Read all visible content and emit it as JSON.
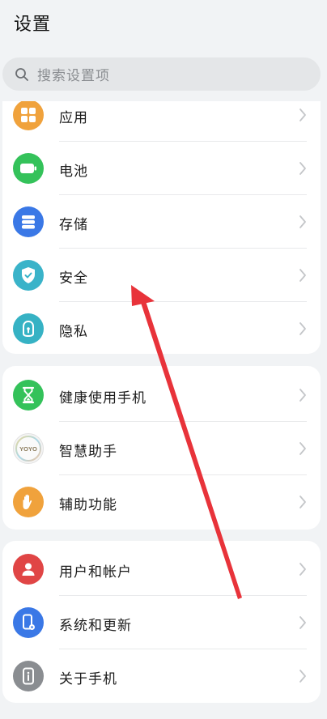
{
  "header": {
    "title": "设置"
  },
  "search": {
    "placeholder": "搜索设置项"
  },
  "groups": [
    {
      "items": [
        {
          "label": "应用",
          "icon": "apps-grid-icon",
          "color": "#f0a23c"
        },
        {
          "label": "电池",
          "icon": "battery-icon",
          "color": "#34c25a"
        },
        {
          "label": "存储",
          "icon": "storage-icon",
          "color": "#3a78e6"
        },
        {
          "label": "安全",
          "icon": "shield-check-icon",
          "color": "#3ab3c9"
        },
        {
          "label": "隐私",
          "icon": "privacy-lock-icon",
          "color": "#36b2c4"
        }
      ]
    },
    {
      "items": [
        {
          "label": "健康使用手机",
          "icon": "hourglass-icon",
          "color": "#34c25a"
        },
        {
          "label": "智慧助手",
          "icon": "yoyo-assistant-icon",
          "color": "#eeeeee",
          "icon_text": "YOYO"
        },
        {
          "label": "辅助功能",
          "icon": "hand-icon",
          "color": "#f0a23c"
        }
      ]
    },
    {
      "items": [
        {
          "label": "用户和帐户",
          "icon": "user-icon",
          "color": "#e04545"
        },
        {
          "label": "系统和更新",
          "icon": "phone-update-icon",
          "color": "#3a78e6"
        },
        {
          "label": "关于手机",
          "icon": "info-phone-icon",
          "color": "#8a8d91"
        }
      ]
    }
  ],
  "annotation": {
    "icon": "red-arrow-icon",
    "color": "#e8333a"
  }
}
